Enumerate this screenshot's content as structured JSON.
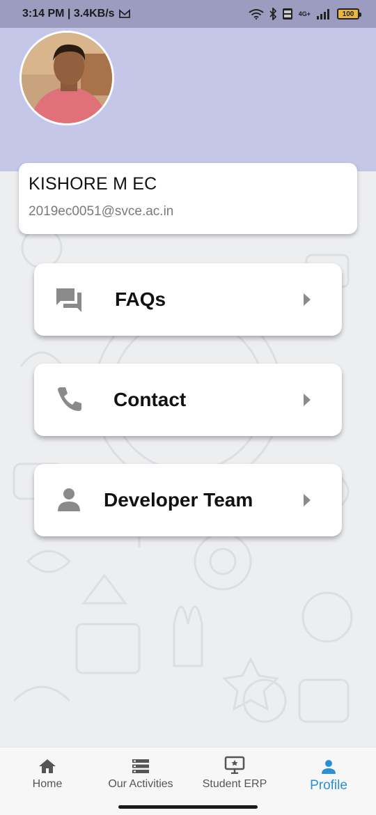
{
  "status_bar": {
    "time_speed": "3:14 PM | 3.4KB/s",
    "network_label": "4G+",
    "battery": "100"
  },
  "user": {
    "name": "KISHORE M EC",
    "email": "2019ec0051@svce.ac.in"
  },
  "menu": [
    {
      "label": "FAQs",
      "icon": "chat-icon"
    },
    {
      "label": "Contact",
      "icon": "phone-icon"
    },
    {
      "label": "Developer Team",
      "icon": "person-icon"
    }
  ],
  "nav": [
    {
      "label": "Home",
      "icon": "home-icon",
      "active": false
    },
    {
      "label": "Our Activities",
      "icon": "list-icon",
      "active": false
    },
    {
      "label": "Student ERP",
      "icon": "monitor-icon",
      "active": false
    },
    {
      "label": "Profile",
      "icon": "person-icon",
      "active": true
    }
  ],
  "colors": {
    "status_bar": "#9c9cc0",
    "header": "#c4c7e7",
    "accent": "#2a8fd6",
    "icon_gray": "#8a8a8a"
  }
}
